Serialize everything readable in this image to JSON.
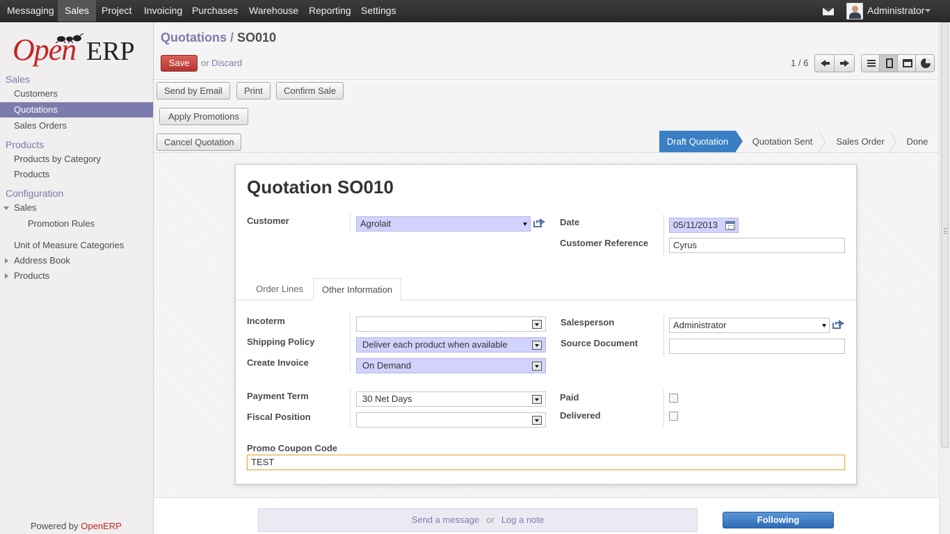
{
  "topbar": {
    "menus": [
      "Messaging",
      "Sales",
      "Project",
      "Invoicing",
      "Purchases",
      "Warehouse",
      "Reporting",
      "Settings"
    ],
    "active_menu": "Sales",
    "user": "Administrator"
  },
  "sidebar": {
    "logo_open": "Open",
    "logo_erp": "ERP",
    "sections": {
      "sales": "Sales",
      "products": "Products",
      "configuration": "Configuration"
    },
    "items": {
      "customers": "Customers",
      "quotations": "Quotations",
      "sales_orders": "Sales Orders",
      "products_by_category": "Products by Category",
      "products": "Products",
      "config_sales": "Sales",
      "promotion_rules": "Promotion Rules",
      "uom_categories": "Unit of Measure Categories",
      "address_book": "Address Book",
      "config_products": "Products"
    },
    "powered_by": "Powered by ",
    "powered_brand": "OpenERP"
  },
  "header": {
    "breadcrumb_parent": "Quotations",
    "breadcrumb_sep": " / ",
    "breadcrumb_current": "SO010",
    "save_label": "Save",
    "or_text": "or",
    "discard_label": "Discard",
    "pager": "1 / 6"
  },
  "actions": {
    "send_by_email": "Send by Email",
    "print": "Print",
    "confirm_sale": "Confirm Sale",
    "apply_promotions": "Apply Promotions",
    "cancel_quotation": "Cancel Quotation"
  },
  "status_bar": {
    "steps": [
      "Draft Quotation",
      "Quotation Sent",
      "Sales Order",
      "Done"
    ],
    "active": "Draft Quotation"
  },
  "form": {
    "title": "Quotation SO010",
    "customer_label": "Customer",
    "customer_value": "Agrolait",
    "date_label": "Date",
    "date_value": "05/11/2013",
    "customer_ref_label": "Customer Reference",
    "customer_ref_value": "Cyrus",
    "tabs": [
      "Order Lines",
      "Other Information"
    ],
    "active_tab": "Other Information",
    "incoterm_label": "Incoterm",
    "incoterm_value": "",
    "shipping_policy_label": "Shipping Policy",
    "shipping_policy_value": "Deliver each product when available",
    "create_invoice_label": "Create Invoice",
    "create_invoice_value": "On Demand",
    "salesperson_label": "Salesperson",
    "salesperson_value": "Administrator",
    "source_document_label": "Source Document",
    "source_document_value": "",
    "payment_term_label": "Payment Term",
    "payment_term_value": "30 Net Days",
    "fiscal_position_label": "Fiscal Position",
    "fiscal_position_value": "",
    "paid_label": "Paid",
    "paid_checked": false,
    "delivered_label": "Delivered",
    "delivered_checked": false,
    "promo_label": "Promo Coupon Code",
    "promo_value": "TEST"
  },
  "chatter": {
    "send_message": "Send a message",
    "or_text": "or",
    "log_note": "Log a note",
    "following": "Following"
  }
}
